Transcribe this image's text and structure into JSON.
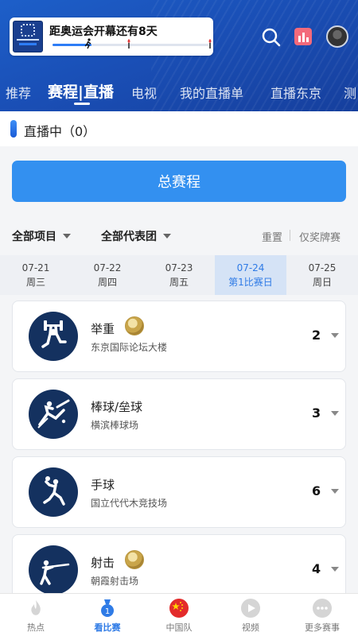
{
  "header": {
    "countdown_text": "距奥运会开幕还有8天",
    "countdown_progress": 0.25,
    "tabs": [
      "推荐",
      "赛程|直播",
      "电视",
      "我的直播单",
      "直播东京",
      "测"
    ],
    "active_tab": 1,
    "icons": [
      "search-icon",
      "stats-icon",
      "avatar"
    ]
  },
  "live": {
    "label": "直播中（0）"
  },
  "schedule_button": {
    "label": "总赛程"
  },
  "filters": {
    "sport": "全部项目",
    "team": "全部代表团",
    "reset": "重置",
    "medal_only": "仅奖牌赛"
  },
  "dates": [
    {
      "date": "07-21",
      "day": "周三"
    },
    {
      "date": "07-22",
      "day": "周四"
    },
    {
      "date": "07-23",
      "day": "周五"
    },
    {
      "date": "07-24",
      "day": "第1比赛日",
      "active": true
    },
    {
      "date": "07-25",
      "day": "周日"
    }
  ],
  "events": [
    {
      "name": "举重",
      "venue": "东京国际论坛大楼",
      "count": "2",
      "medal": true,
      "icon": "weightlifting-icon"
    },
    {
      "name": "棒球/垒球",
      "venue": "横滨棒球场",
      "count": "3",
      "medal": false,
      "icon": "baseball-icon"
    },
    {
      "name": "手球",
      "venue": "国立代代木竞技场",
      "count": "6",
      "medal": false,
      "icon": "handball-icon"
    },
    {
      "name": "射击",
      "venue": "朝霞射击场",
      "count": "4",
      "medal": true,
      "icon": "shooting-icon"
    }
  ],
  "bottom_nav": [
    {
      "label": "热点",
      "icon": "fire-icon"
    },
    {
      "label": "看比赛",
      "icon": "match-icon",
      "active": true
    },
    {
      "label": "中国队",
      "icon": "china-flag-icon"
    },
    {
      "label": "视频",
      "icon": "video-icon"
    },
    {
      "label": "更多赛事",
      "icon": "more-icon"
    }
  ],
  "colors": {
    "header_blue": "#1a4fb6",
    "accent": "#3390f0",
    "active_date_bg": "#d5e3f6",
    "active_text": "#2f7be6",
    "pictogram_bg": "#14315f"
  }
}
